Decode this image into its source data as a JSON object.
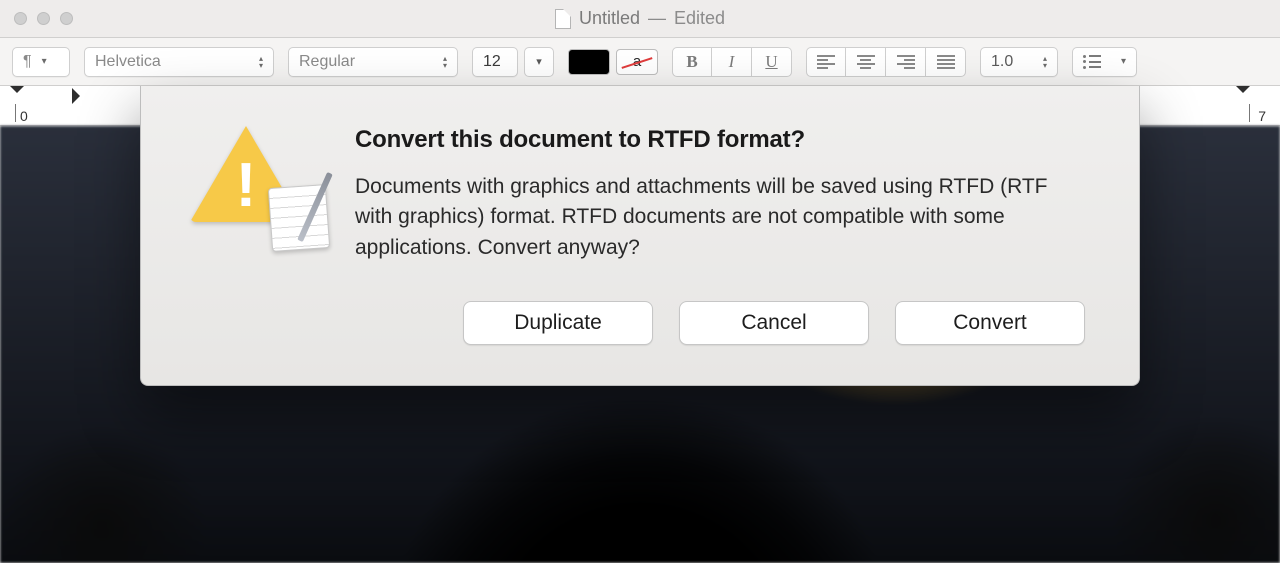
{
  "window": {
    "doc_name": "Untitled",
    "state": "Edited",
    "separator": "—"
  },
  "toolbar": {
    "para_marker": "¶",
    "font_family": "Helvetica",
    "font_style": "Regular",
    "font_size": "12",
    "text_color_label": "a",
    "bold": "B",
    "italic": "I",
    "underline": "U",
    "line_spacing": "1.0"
  },
  "ruler": {
    "left_num": "0",
    "right_num": "7"
  },
  "dialog": {
    "title": "Convert this document to RTFD format?",
    "body": "Documents with graphics and attachments will be saved using RTFD (RTF with graphics) format. RTFD documents are not compatible with some applications. Convert anyway?",
    "duplicate": "Duplicate",
    "cancel": "Cancel",
    "convert": "Convert"
  }
}
